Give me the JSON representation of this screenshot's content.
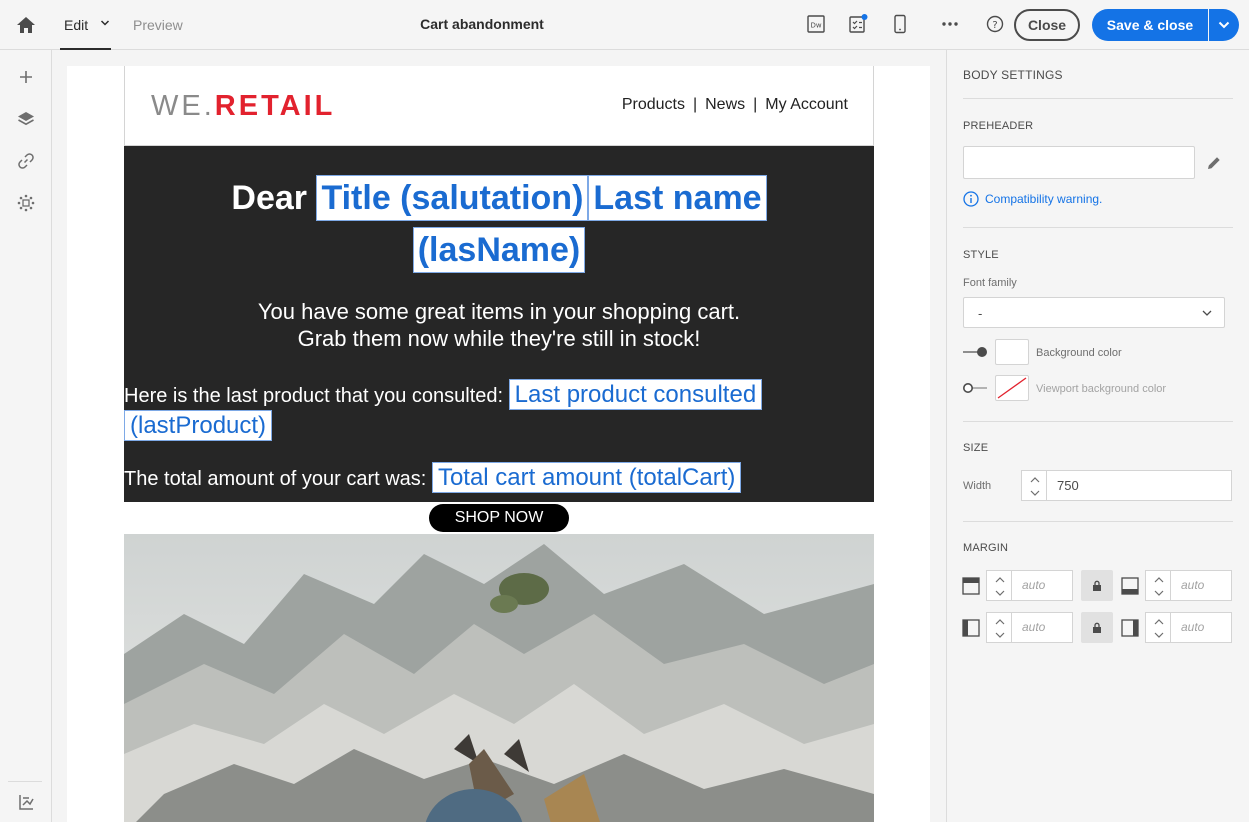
{
  "topbar": {
    "tab_edit": "Edit",
    "tab_preview": "Preview",
    "title": "Cart abandonment",
    "close_label": "Close",
    "save_label": "Save & close"
  },
  "email": {
    "logo_we": "WE.",
    "logo_retail": "RETAIL",
    "nav": [
      "Products",
      "News",
      "My Account"
    ],
    "nav_sep": "|",
    "greeting": "Dear",
    "field_title": "Title (salutation)",
    "field_lastname": "Last name",
    "field_lastname_key": "(lasName)",
    "intro_line1": "You have some great items in your shopping cart.",
    "intro_line2": "Grab them now while they're still in stock!",
    "last_product_text": "Here is the last product that you consulted:",
    "field_last_product": "Last product consulted",
    "field_last_product_key": "(lastProduct)",
    "total_text": "The total amount of your cart was:",
    "field_total": "Total cart amount (totalCart)",
    "shop_button": "SHOP NOW"
  },
  "panel": {
    "body_settings": "BODY SETTINGS",
    "preheader": "PREHEADER",
    "preheader_value": "",
    "compat_warning": "Compatibility warning.",
    "style": "STYLE",
    "font_family_label": "Font family",
    "font_family_value": "-",
    "bg_color_label": "Background color",
    "viewport_bg_label": "Viewport background color",
    "size": "SIZE",
    "width_label": "Width",
    "width_value": "750",
    "margin": "MARGIN",
    "margin_top": "auto",
    "margin_bottom": "auto",
    "margin_left": "auto",
    "margin_right": "auto"
  },
  "colors": {
    "accent": "#1473e6",
    "logo_red": "#e2222e",
    "dark_block": "#262626"
  }
}
